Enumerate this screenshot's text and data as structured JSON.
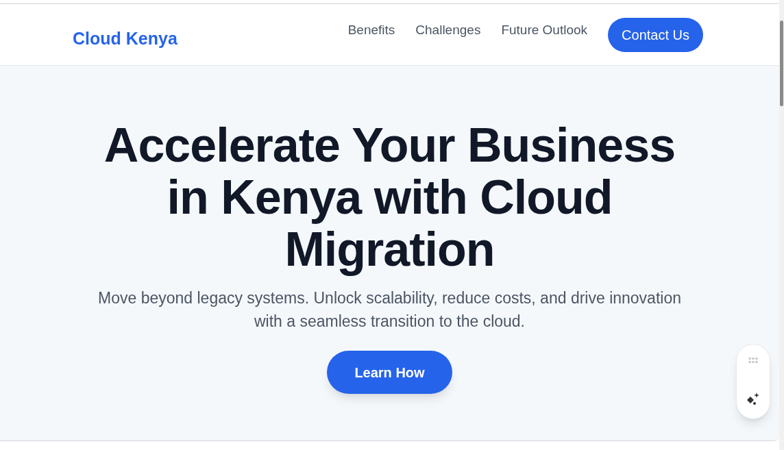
{
  "header": {
    "logo": "Cloud Kenya",
    "nav": [
      "Benefits",
      "Challenges",
      "Future Outlook"
    ],
    "cta": "Contact Us"
  },
  "hero": {
    "title": "Accelerate Your Business in Kenya with Cloud Migration",
    "subtitle": "Move beyond legacy systems. Unlock scalability, reduce costs, and drive innovation with a seamless transition to the cloud.",
    "button": "Learn How"
  }
}
